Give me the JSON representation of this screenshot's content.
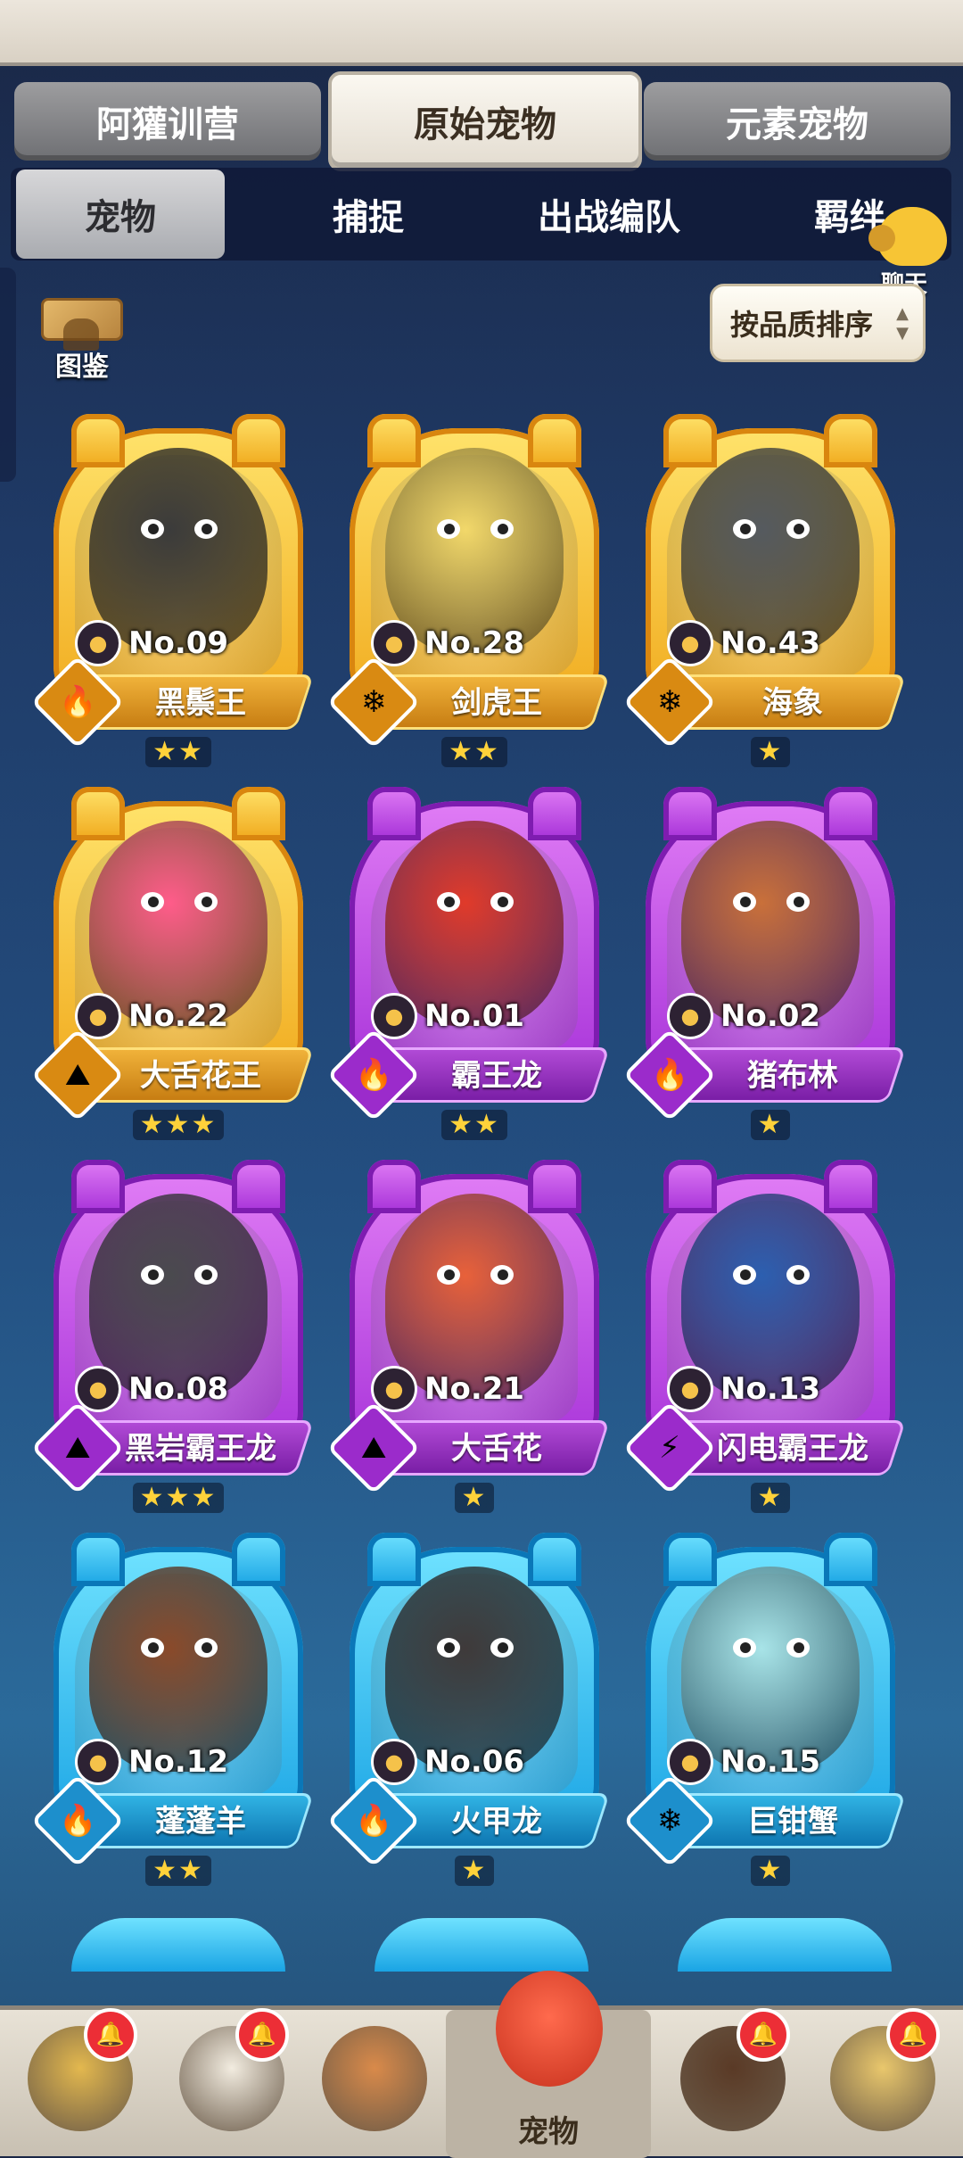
{
  "main_tabs": [
    "阿獾训营",
    "原始宠物",
    "元素宠物"
  ],
  "active_main_tab": 1,
  "sub_tabs": [
    "宠物",
    "捕捉",
    "出战编队",
    "羁绊"
  ],
  "active_sub_tab": 0,
  "atlas_label": "图鉴",
  "chat_label": "聊天",
  "sort_label": "按品质排序",
  "pets": [
    {
      "no": "No.09",
      "name": "黑鬃王",
      "stars": 2,
      "rarity": "gold",
      "element": "fire",
      "color": "#3b3b3b"
    },
    {
      "no": "No.28",
      "name": "剑虎王",
      "stars": 2,
      "rarity": "gold",
      "element": "ice",
      "color": "#f2d86a"
    },
    {
      "no": "No.43",
      "name": "海象",
      "stars": 1,
      "rarity": "gold",
      "element": "ice",
      "color": "#555a5f"
    },
    {
      "no": "No.22",
      "name": "大舌花王",
      "stars": 3,
      "rarity": "gold",
      "element": "earth",
      "color": "#ff5c8a"
    },
    {
      "no": "No.01",
      "name": "霸王龙",
      "stars": 2,
      "rarity": "purple",
      "element": "fire",
      "color": "#e03a2a"
    },
    {
      "no": "No.02",
      "name": "猪布林",
      "stars": 1,
      "rarity": "purple",
      "element": "fire",
      "color": "#c9703a"
    },
    {
      "no": "No.08",
      "name": "黑岩霸王龙",
      "stars": 3,
      "rarity": "purple",
      "element": "earth",
      "color": "#4a4a4e"
    },
    {
      "no": "No.21",
      "name": "大舌花",
      "stars": 1,
      "rarity": "purple",
      "element": "earth",
      "color": "#e8613a"
    },
    {
      "no": "No.13",
      "name": "闪电霸王龙",
      "stars": 1,
      "rarity": "purple",
      "element": "lightning",
      "color": "#2c5fb0"
    },
    {
      "no": "No.12",
      "name": "蓬蓬羊",
      "stars": 2,
      "rarity": "blue",
      "element": "fire",
      "color": "#8a4a2a"
    },
    {
      "no": "No.06",
      "name": "火甲龙",
      "stars": 1,
      "rarity": "blue",
      "element": "fire",
      "color": "#3f3a3a"
    },
    {
      "no": "No.15",
      "name": "巨钳蟹",
      "stars": 1,
      "rarity": "blue",
      "element": "ice",
      "color": "#a8e4e8"
    }
  ],
  "bottom_nav": [
    {
      "label": "",
      "badge": true,
      "color": "#e3b84e"
    },
    {
      "label": "",
      "badge": true,
      "color": "#f2ece0"
    },
    {
      "label": "",
      "badge": false,
      "color": "#d98a4a"
    },
    {
      "label": "宠物",
      "badge": false,
      "color": "#ff5a3d",
      "active": true
    },
    {
      "label": "",
      "badge": true,
      "color": "#5a3a26"
    },
    {
      "label": "",
      "badge": true,
      "color": "#e9c76c"
    }
  ]
}
